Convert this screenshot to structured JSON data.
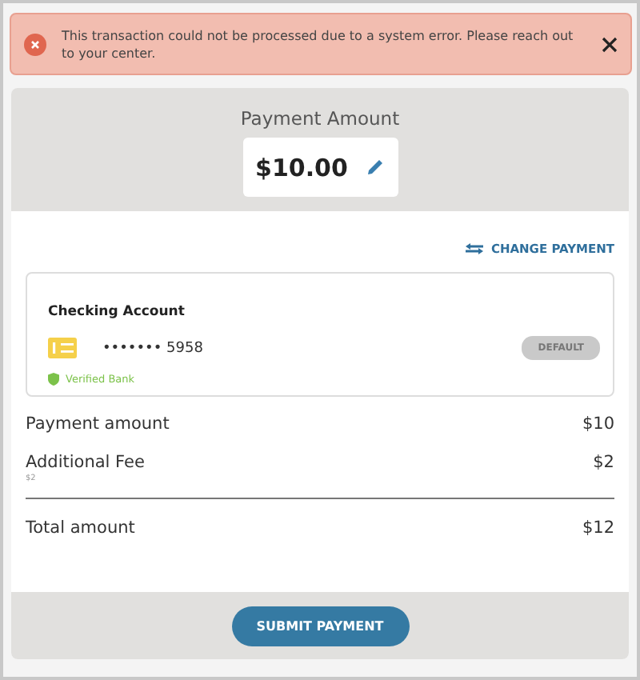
{
  "alert": {
    "message": "This transaction could not be processed due to a system error. Please reach out to your center."
  },
  "payment": {
    "title": "Payment Amount",
    "amount": "$10.00"
  },
  "change_payment": "CHANGE PAYMENT",
  "account": {
    "name": "Checking Account",
    "number": "••••••• 5958",
    "badge": "DEFAULT",
    "verified": "Verified Bank"
  },
  "lines": [
    {
      "label": "Payment amount",
      "value": "$10"
    },
    {
      "label": "Additional Fee",
      "value": "$2",
      "note": "$2"
    }
  ],
  "total": {
    "label": "Total amount",
    "value": "$12"
  },
  "submit": "SUBMIT PAYMENT"
}
